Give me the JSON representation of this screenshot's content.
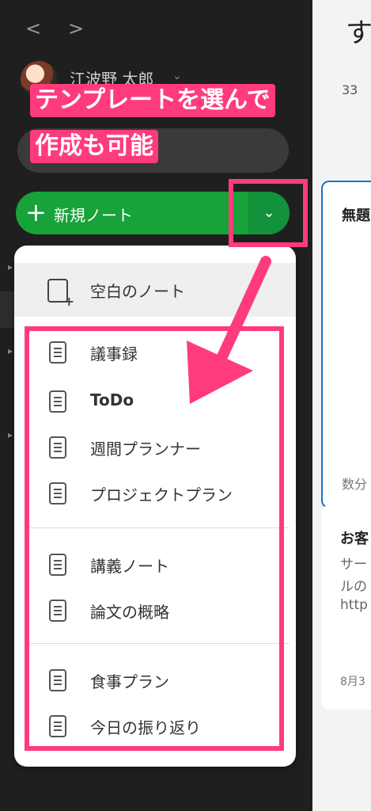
{
  "nav": {
    "back": "<",
    "forward": ">"
  },
  "user": {
    "name": "江波野 太郎",
    "chevron": "⌄"
  },
  "new_note": {
    "plus": "+",
    "label": "新規ノート",
    "chevron": "⌄"
  },
  "menu": {
    "blank": "空白のノート",
    "group1": [
      "議事録",
      "ToDo",
      "週間プランナー",
      "プロジェクトプラン"
    ],
    "group2": [
      "講義ノート",
      "論文の概略"
    ],
    "group3": [
      "食事プラン",
      "今日の振り返り"
    ]
  },
  "callout": {
    "line1": "テンプレートを選んで",
    "line2": "作成も可能"
  },
  "main": {
    "title": "す",
    "count": "33",
    "card1_title": "無題",
    "card1_meta": "数分",
    "card2_title": "お客",
    "card2_line1": "サー",
    "card2_line2": "ルの",
    "card2_line3": "http",
    "card2_date": "8月3"
  },
  "colors": {
    "accent": "#17a23a",
    "highlight": "#ff3b7d",
    "selected": "#1a73c9"
  }
}
